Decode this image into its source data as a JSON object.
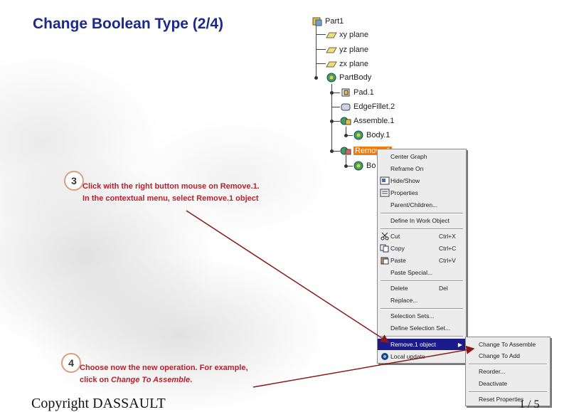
{
  "title": "Change Boolean Type (2/4)",
  "tree": {
    "nodes": [
      {
        "label": "Part1",
        "icon": "part-icon"
      },
      {
        "label": "xy plane",
        "icon": "plane-icon"
      },
      {
        "label": "yz plane",
        "icon": "plane-icon"
      },
      {
        "label": "zx plane",
        "icon": "plane-icon"
      },
      {
        "label": "PartBody",
        "icon": "body-icon"
      },
      {
        "label": "Pad.1",
        "icon": "pad-icon"
      },
      {
        "label": "EdgeFillet.2",
        "icon": "fillet-icon"
      },
      {
        "label": "Assemble.1",
        "icon": "assemble-icon"
      },
      {
        "label": "Body.1",
        "icon": "body-icon"
      },
      {
        "label": "Remove.1",
        "icon": "remove-icon"
      },
      {
        "label": "Bo",
        "icon": "body-icon"
      }
    ]
  },
  "context_menu": {
    "items": [
      {
        "label": "Center Graph",
        "shortcut": ""
      },
      {
        "label": "Reframe On",
        "shortcut": ""
      },
      {
        "label": "Hide/Show",
        "shortcut": "",
        "icon": "hide-show-icon"
      },
      {
        "label": "Properties",
        "shortcut": "",
        "icon": "properties-icon"
      },
      {
        "label": "Parent/Children...",
        "shortcut": ""
      },
      {
        "label": "Define In Work Object",
        "shortcut": ""
      },
      {
        "label": "Cut",
        "shortcut": "Ctrl+X",
        "icon": "cut-icon"
      },
      {
        "label": "Copy",
        "shortcut": "Ctrl+C",
        "icon": "copy-icon"
      },
      {
        "label": "Paste",
        "shortcut": "Ctrl+V",
        "icon": "paste-icon"
      },
      {
        "label": "Paste Special...",
        "shortcut": ""
      },
      {
        "label": "Delete",
        "shortcut": "Del"
      },
      {
        "label": "Replace...",
        "shortcut": ""
      },
      {
        "label": "Selection Sets...",
        "shortcut": ""
      },
      {
        "label": "Define Selection Set...",
        "shortcut": ""
      },
      {
        "label": "Remove.1 object",
        "shortcut": ""
      },
      {
        "label": "Local update",
        "shortcut": "",
        "icon": "local-update-icon"
      }
    ]
  },
  "submenu": {
    "items": [
      {
        "label": "Change To Assemble"
      },
      {
        "label": "Change To Add"
      },
      {
        "label": "Reorder..."
      },
      {
        "label": "Deactivate"
      },
      {
        "label": "Reset Properties"
      }
    ]
  },
  "steps": [
    {
      "number": "3",
      "text": "Click with the right button mouse on Remove.1. In the contextual menu, select Remove.1 object"
    },
    {
      "number": "4",
      "text_prefix": "Choose now the new operation. For example, click on ",
      "text_italic": "Change To Assemble",
      "text_suffix": "."
    }
  ],
  "footer": {
    "copyright": "Copyright DASSAULT",
    "page": "1 / 5"
  },
  "colors": {
    "title": "#1b2a8c",
    "step_text": "#b8202a",
    "highlight": "#f07a10",
    "menu_selected": "#1a1a8c"
  }
}
